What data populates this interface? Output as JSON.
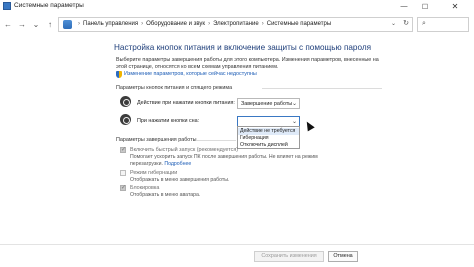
{
  "window": {
    "title": "Системные параметры",
    "controls": {
      "minimize": "—",
      "maximize": "☐",
      "close": "✕"
    }
  },
  "nav": {
    "back": "←",
    "forward": "→",
    "dropdown": "⌄",
    "up": "↑",
    "breadcrumbs": [
      "Панель управления",
      "Оборудование и звук",
      "Электропитание",
      "Системные параметры"
    ],
    "separator": "›",
    "address_dropdown": "⌄",
    "refresh": "↻",
    "search_icon": "⌕"
  },
  "main": {
    "title": "Настройка кнопок питания и включение защиты с помощью пароля",
    "description": "Выберите параметры завершения работы для этого компьютера. Изменения параметров, внесенные на этой странице, относятся ко всем схемам управления питанием.",
    "change_link": "Изменение параметров, которые сейчас недоступны"
  },
  "power_buttons": {
    "section_title": "Параметры кнопок питания и спящего режима",
    "power_button_label": "Действие при нажатии кнопки питания:",
    "power_button_value": "Завершение работы",
    "sleep_button_label": "При нажатии кнопки сна:",
    "sleep_button_value": "",
    "dropdown_options": [
      "Действие не требуется",
      "Гибернация",
      "Отключить дисплей"
    ],
    "selected_option_index": 0
  },
  "shutdown": {
    "section_title": "Параметры завершения работы",
    "fast_startup_label": "Включить быстрый запуск (рекомендуется)",
    "fast_startup_checked": true,
    "fast_startup_desc": "Помогает ускорить запуск ПК после завершения работы. Не влияет на режим перезагрузки.",
    "fast_startup_link": "Подробнее",
    "hibernate_label": "Режим гибернации",
    "hibernate_checked": false,
    "hibernate_desc": "Отображать в меню завершения работы.",
    "lock_label": "Блокировка",
    "lock_checked": true,
    "lock_desc": "Отображать в меню аватара."
  },
  "footer": {
    "save_label": "Сохранить изменения",
    "cancel_label": "Отмена"
  },
  "colors": {
    "title_blue": "#1e3e7a",
    "link_blue": "#1a5bb5",
    "selection": "#dfeaf8"
  }
}
